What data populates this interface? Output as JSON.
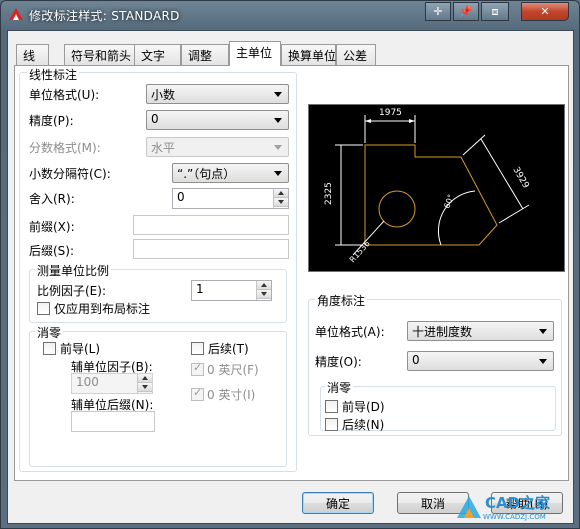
{
  "window": {
    "title": "修改标注样式: STANDARD",
    "buttons": [
      "move-icon",
      "pin-icon",
      "restore-icon",
      "close-icon"
    ]
  },
  "tabs": [
    {
      "label": "线"
    },
    {
      "label": "符号和箭头"
    },
    {
      "label": "文字"
    },
    {
      "label": "调整"
    },
    {
      "label": "主单位",
      "active": true
    },
    {
      "label": "换算单位"
    },
    {
      "label": "公差"
    }
  ],
  "linear": {
    "title": "线性标注",
    "unit_format_label": "单位格式(U):",
    "unit_format_value": "小数",
    "precision_label": "精度(P):",
    "precision_value": "0",
    "fraction_format_label": "分数格式(M):",
    "fraction_format_value": "水平",
    "decimal_sep_label": "小数分隔符(C):",
    "decimal_sep_value": "“.”（句点）",
    "round_off_label": "舍入(R):",
    "round_off_value": "0",
    "prefix_label": "前缀(X):",
    "suffix_label": "后缀(S):"
  },
  "scale": {
    "title": "测量单位比例",
    "factor_label": "比例因子(E):",
    "factor_value": "1",
    "layout_only_label": "仅应用到布局标注"
  },
  "zero_linear": {
    "title": "消零",
    "leading_label": "前导(L)",
    "sub_factor_label": "辅单位因子(B):",
    "sub_factor_value": "100",
    "sub_suffix_label": "辅单位后缀(N):",
    "trailing_label": "后续(T)",
    "feet_label": "0 英尺(F)",
    "inches_label": "0 英寸(I)"
  },
  "preview": {
    "dim_top": "1975",
    "dim_left": "2325",
    "dim_diag": "3929",
    "dim_angle": "60°",
    "dim_radius": "R1536"
  },
  "angular": {
    "title": "角度标注",
    "unit_format_label": "单位格式(A):",
    "unit_format_value": "十进制度数",
    "precision_label": "精度(O):",
    "precision_value": "0",
    "zero_title": "消零",
    "leading_label": "前导(D)",
    "trailing_label": "后续(N)"
  },
  "footer": {
    "ok": "确定",
    "cancel": "取消",
    "help": "帮助(H)"
  },
  "watermark": {
    "text": "CAD之家",
    "url": "WWW.CADZJ.COM"
  },
  "colors": {
    "preview_bg": "#000000",
    "shape": "#d89a2a",
    "dim": "#ffffff"
  }
}
